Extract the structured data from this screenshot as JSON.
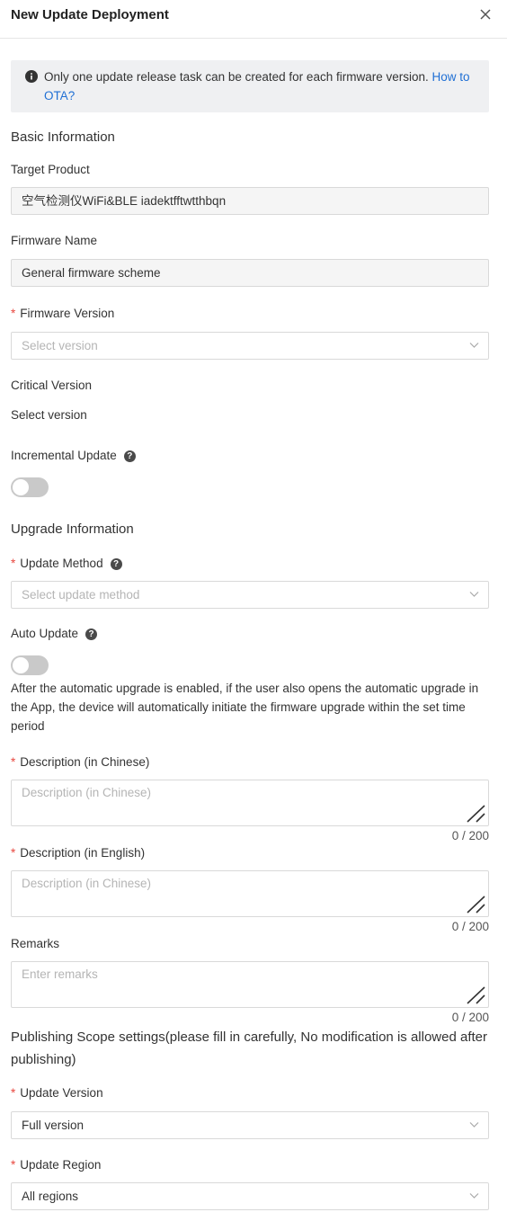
{
  "header": {
    "title": "New Update Deployment"
  },
  "notice": {
    "text": "Only one update release task can be created for each firmware version.",
    "link": "How to OTA?"
  },
  "basic": {
    "section_title": "Basic Information",
    "target_product": {
      "label": "Target Product",
      "value": "空气检测仪WiFi&BLE iadektfftwtthbqn"
    },
    "firmware_name": {
      "label": "Firmware Name",
      "value": "General firmware scheme"
    },
    "firmware_version": {
      "label": "Firmware Version",
      "placeholder": "Select version"
    },
    "critical_version": {
      "label": "Critical Version",
      "value": "Select version"
    },
    "incremental_update": {
      "label": "Incremental Update",
      "enabled": false
    }
  },
  "upgrade": {
    "section_title": "Upgrade Information",
    "update_method": {
      "label": "Update Method",
      "placeholder": "Select update method"
    },
    "auto_update": {
      "label": "Auto Update",
      "enabled": false,
      "hint": "After the automatic upgrade is enabled, if the user also opens the automatic upgrade in the App, the device will automatically initiate the firmware upgrade within the set time period"
    },
    "description_cn": {
      "label": "Description (in Chinese)",
      "placeholder": "Description (in Chinese)",
      "counter": "0 / 200"
    },
    "description_en": {
      "label": "Description (in English)",
      "placeholder": "Description (in Chinese)",
      "counter": "0 / 200"
    },
    "remarks": {
      "label": "Remarks",
      "placeholder": "Enter remarks",
      "counter": "0 / 200"
    }
  },
  "scope": {
    "section_title": "Publishing Scope settings(please fill in carefully, No modification is allowed after publishing)",
    "update_version": {
      "label": "Update Version",
      "value": "Full version"
    },
    "update_region": {
      "label": "Update Region",
      "value": "All regions"
    }
  },
  "colors": {
    "link": "#1f6fd4",
    "required": "#e8473f",
    "toggle_off": "#c9c9c9",
    "notice_bg": "#eff0f2"
  }
}
